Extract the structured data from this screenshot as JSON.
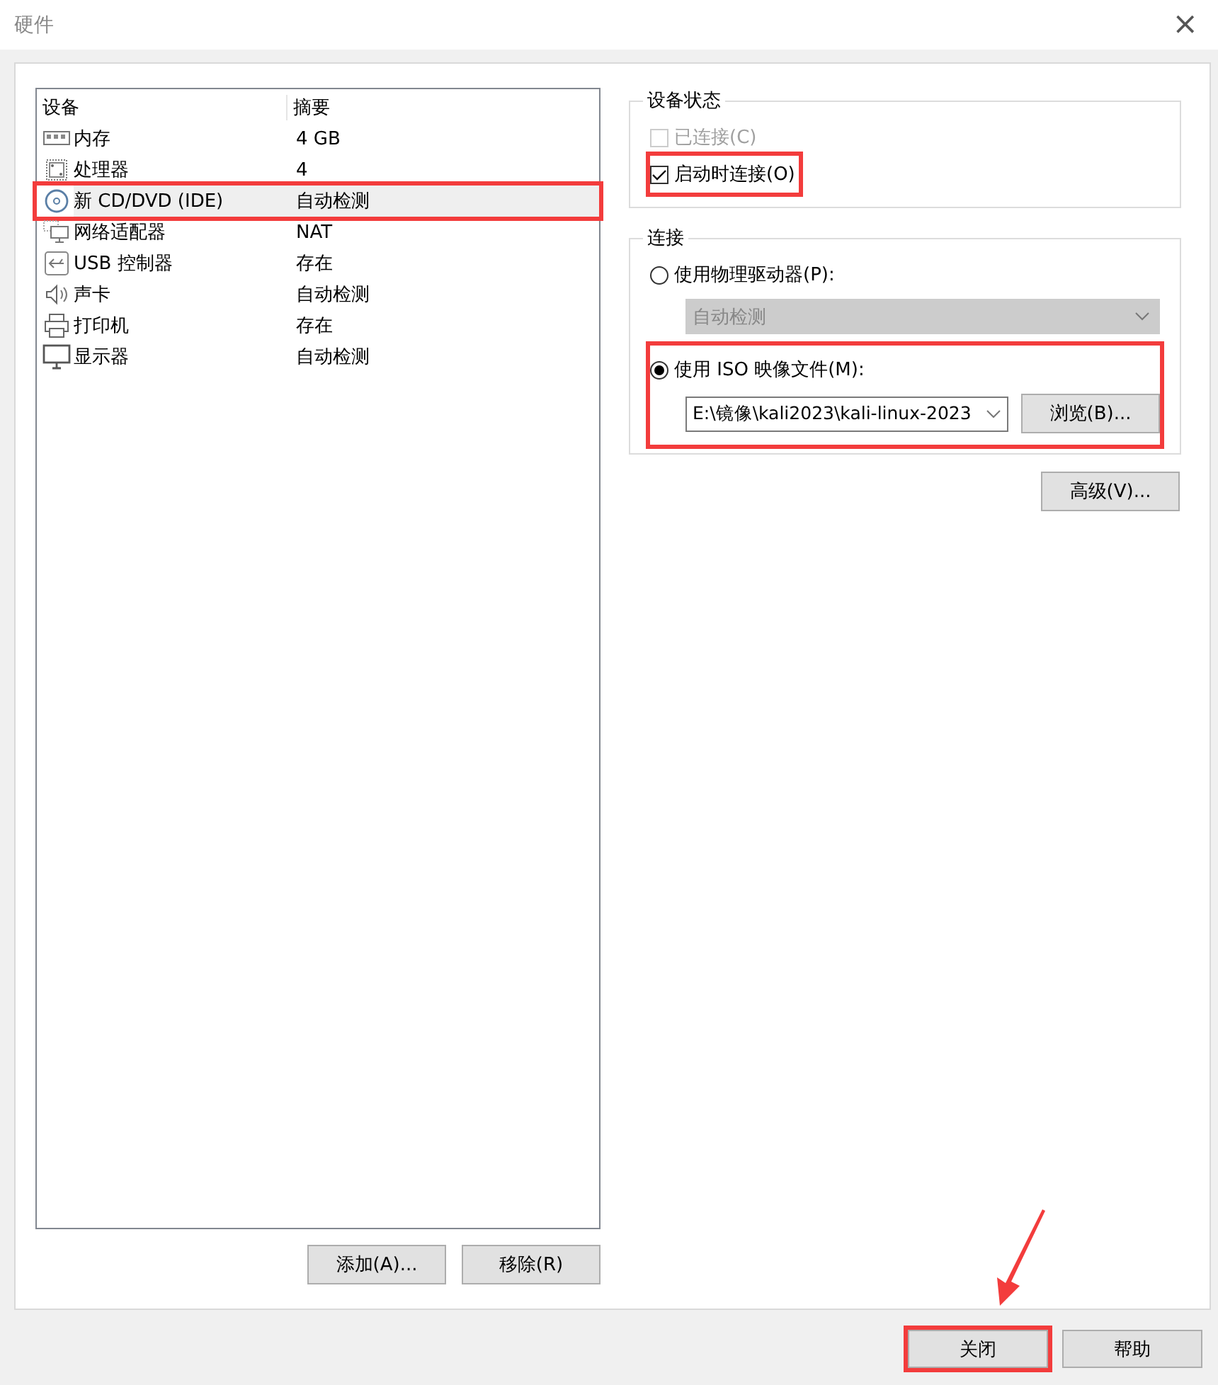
{
  "window": {
    "title": "硬件",
    "close": "×"
  },
  "device_list": {
    "columns": [
      "设备",
      "摘要"
    ],
    "rows": [
      {
        "kind": "memory",
        "device": "内存",
        "summary": "4 GB",
        "selected": false,
        "highlighted": false
      },
      {
        "kind": "processor",
        "device": "处理器",
        "summary": "4",
        "selected": false,
        "highlighted": false
      },
      {
        "kind": "disc",
        "device": "新 CD/DVD (IDE)",
        "summary": "自动检测",
        "selected": true,
        "highlighted": true
      },
      {
        "kind": "network",
        "device": "网络适配器",
        "summary": "NAT",
        "selected": false,
        "highlighted": false
      },
      {
        "kind": "usb",
        "device": "USB 控制器",
        "summary": "存在",
        "selected": false,
        "highlighted": false
      },
      {
        "kind": "sound",
        "device": "声卡",
        "summary": "自动检测",
        "selected": false,
        "highlighted": false
      },
      {
        "kind": "printer",
        "device": "打印机",
        "summary": "存在",
        "selected": false,
        "highlighted": false
      },
      {
        "kind": "display",
        "device": "显示器",
        "summary": "自动检测",
        "selected": false,
        "highlighted": false
      }
    ],
    "buttons": [
      "添加(A)...",
      "移除(R)"
    ]
  },
  "device_status": {
    "title": "设备状态",
    "options": [
      {
        "label": "已连接(C)",
        "checked": false,
        "disabled": true,
        "highlighted": false
      },
      {
        "label": "启动时连接(O)",
        "checked": true,
        "disabled": false,
        "highlighted": true
      }
    ]
  },
  "connection": {
    "title": "连接",
    "physical": {
      "label": "使用物理驱动器(P):",
      "selected": false,
      "dropdown": {
        "value": "自动检测",
        "disabled": true
      }
    },
    "iso": {
      "label": "使用 ISO 映像文件(M):",
      "selected": true,
      "highlighted": true,
      "path": "E:\\镜像\\kali2023\\kali-linux-2023",
      "browse": "浏览(B)..."
    }
  },
  "advanced_button": "高级(V)...",
  "footer": {
    "buttons": [
      {
        "label": "关闭",
        "highlighted": true,
        "arrow": true
      },
      {
        "label": "帮助",
        "highlighted": false,
        "arrow": false
      }
    ]
  }
}
